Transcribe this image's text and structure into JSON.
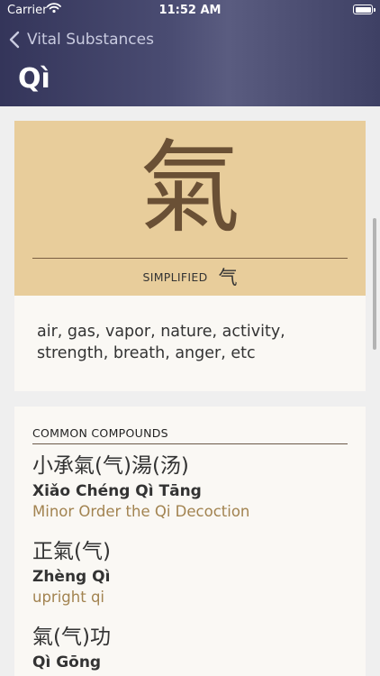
{
  "status_bar": {
    "carrier": "Carrier",
    "time": "11:52 AM"
  },
  "nav": {
    "back_label": "Vital Substances",
    "title": "Qì"
  },
  "character": {
    "traditional": "氣",
    "simplified_label": "SIMPLIFIED",
    "simplified": "气"
  },
  "definition": {
    "text": "air, gas, vapor, nature, activity, strength, breath, anger, etc"
  },
  "compounds": {
    "header": "COMMON COMPOUNDS",
    "items": [
      {
        "hanzi": "小承氣(气)湯(汤)",
        "pinyin": "Xiǎo Chéng Qì Tāng",
        "english": "Minor Order the Qi Decoction"
      },
      {
        "hanzi": "正氣(气)",
        "pinyin": "Zhèng Qì",
        "english": "upright qi"
      },
      {
        "hanzi": "氣(气)功",
        "pinyin": "Qì Gōng",
        "english": ""
      }
    ]
  },
  "colors": {
    "nav_background": "#414368",
    "character_card": "#e8cd9b",
    "character_ink": "#6a5035",
    "card_background": "#faf8f4",
    "english_accent": "#a28350"
  }
}
